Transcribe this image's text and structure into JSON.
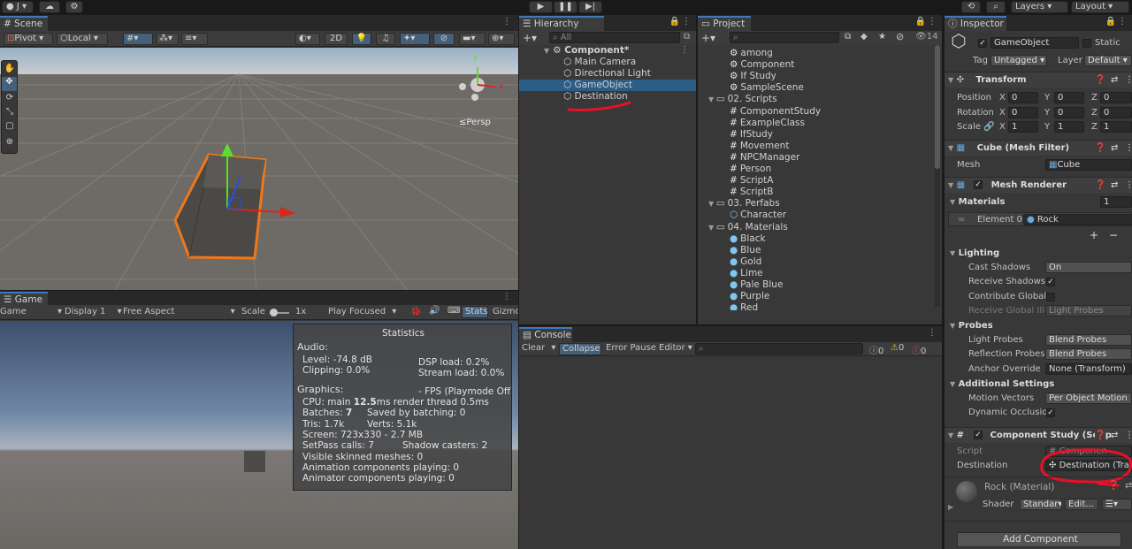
{
  "topbar": {
    "account": "J",
    "play": "▶",
    "pause": "❚❚",
    "step": "▶|",
    "history_icon": "history-icon",
    "search_icon": "search-icon",
    "settings_icon": "settings-icon",
    "layers": "Layers",
    "layout": "Layout"
  },
  "scene": {
    "tab": "Scene",
    "pivot": "Pivot",
    "local": "Local",
    "twod": "2D",
    "persp": "≤Persp",
    "gizmo_axes": {
      "x": "x",
      "y": "y"
    }
  },
  "game": {
    "tab": "Game",
    "game": "Game",
    "display": "Display 1",
    "aspect": "Free Aspect",
    "scale_label": "Scale",
    "scale_value": "1x",
    "play_focused": "Play Focused",
    "stats": "Stats",
    "gizmos": "Gizmo"
  },
  "statistics": {
    "title": "Statistics",
    "audio": "Audio:",
    "level": "Level: -74.8 dB",
    "clipping": "Clipping: 0.0%",
    "dsp": "DSP load: 0.2%",
    "stream": "Stream load: 0.0%",
    "graphics": "Graphics:",
    "fps": "- FPS (Playmode Off",
    "cpu_a": "CPU: main ",
    "cpu_b": "12.5",
    "cpu_c": "ms  render thread 0.5ms",
    "batches_a": "Batches: ",
    "batches_b": "7",
    "saved": "Saved by batching: 0",
    "tris": "Tris: 1.7k",
    "verts": "Verts: 5.1k",
    "screen": "Screen: 723x330 - 2.7 MB",
    "setpass": "SetPass calls: 7",
    "shadow": "Shadow casters: 2",
    "skinned": "Visible skinned meshes: 0",
    "anim": "Animation components playing: 0",
    "animator": "Animator components playing: 0"
  },
  "hierarchy": {
    "tab": "Hierarchy",
    "search": "All",
    "scene": "Component*",
    "items": [
      "Main Camera",
      "Directional Light",
      "GameObject",
      "Destination"
    ]
  },
  "project": {
    "tab": "Project",
    "count": "14",
    "items": [
      {
        "label": "among",
        "type": "scene",
        "indent": 2
      },
      {
        "label": "Component",
        "type": "scene",
        "indent": 2
      },
      {
        "label": "If Study",
        "type": "scene",
        "indent": 2
      },
      {
        "label": "SampleScene",
        "type": "scene",
        "indent": 2
      },
      {
        "label": "02. Scripts",
        "type": "folder",
        "indent": 1
      },
      {
        "label": "ComponentStudy",
        "type": "script",
        "indent": 2
      },
      {
        "label": "ExampleClass",
        "type": "script",
        "indent": 2
      },
      {
        "label": "IfStudy",
        "type": "script",
        "indent": 2
      },
      {
        "label": "Movement",
        "type": "script",
        "indent": 2
      },
      {
        "label": "NPCManager",
        "type": "script",
        "indent": 2
      },
      {
        "label": "Person",
        "type": "script",
        "indent": 2
      },
      {
        "label": "ScriptA",
        "type": "script",
        "indent": 2
      },
      {
        "label": "ScriptB",
        "type": "script",
        "indent": 2
      },
      {
        "label": "03. Perfabs",
        "type": "folder",
        "indent": 1
      },
      {
        "label": "Character",
        "type": "prefab",
        "indent": 2
      },
      {
        "label": "04. Materials",
        "type": "folder",
        "indent": 1
      },
      {
        "label": "Black",
        "type": "material",
        "indent": 2
      },
      {
        "label": "Blue",
        "type": "material",
        "indent": 2
      },
      {
        "label": "Gold",
        "type": "material",
        "indent": 2
      },
      {
        "label": "Lime",
        "type": "material",
        "indent": 2
      },
      {
        "label": "Pale Blue",
        "type": "material",
        "indent": 2
      },
      {
        "label": "Purple",
        "type": "material",
        "indent": 2
      },
      {
        "label": "Red",
        "type": "material",
        "indent": 2
      }
    ]
  },
  "console": {
    "tab": "Console",
    "clear": "Clear",
    "collapse": "Collapse",
    "error_pause": "Error Pause",
    "editor": "Editor",
    "c_info": "0",
    "c_warn": "0",
    "c_err": "0"
  },
  "inspector": {
    "tab": "Inspector",
    "name": "GameObject",
    "static": "Static",
    "tag_label": "Tag",
    "tag": "Untagged",
    "layer_label": "Layer",
    "layer": "Default",
    "transform": {
      "title": "Transform",
      "position": "Position",
      "rotation": "Rotation",
      "scale": "Scale",
      "x": "X",
      "y": "Y",
      "z": "Z",
      "pos": [
        "0",
        "0",
        "0"
      ],
      "rot": [
        "0",
        "0",
        "0"
      ],
      "scl": [
        "1",
        "1",
        "1"
      ]
    },
    "mesh_filter": {
      "title": "Cube (Mesh Filter)",
      "mesh_label": "Mesh",
      "mesh": "Cube"
    },
    "mesh_renderer": {
      "title": "Mesh Renderer",
      "materials": "Materials",
      "materials_count": "1",
      "element": "Element 0",
      "element_value": "Rock",
      "plus": "+",
      "minus": "−",
      "lighting": "Lighting",
      "cast": "Cast Shadows",
      "cast_value": "On",
      "receive": "Receive Shadows",
      "contribute": "Contribute Global I",
      "receive_gi": "Receive Global Illu",
      "receive_gi_value": "Light Probes",
      "probes": "Probes",
      "light_probes": "Light Probes",
      "light_probes_value": "Blend Probes",
      "reflection": "Reflection Probes",
      "reflection_value": "Blend Probes",
      "anchor": "Anchor Override",
      "anchor_value": "None (Transform)",
      "additional": "Additional Settings",
      "motion": "Motion Vectors",
      "motion_value": "Per Object Motion",
      "dynamic": "Dynamic Occlusio"
    },
    "component_study": {
      "title": "Component Study (Scrip",
      "script_label": "Script",
      "script_value": "Componen",
      "dest_label": "Destination",
      "dest_value": "Destination (Tra"
    },
    "material": {
      "name": "Rock (Material)",
      "shader_label": "Shader",
      "shader": "Standar",
      "edit": "Edit..."
    },
    "add_component": "Add Component"
  },
  "colors": {
    "accent": "#3a79bb",
    "selection": "#2c5d87",
    "orange": "#f07818",
    "annotation": "#e8102a"
  }
}
